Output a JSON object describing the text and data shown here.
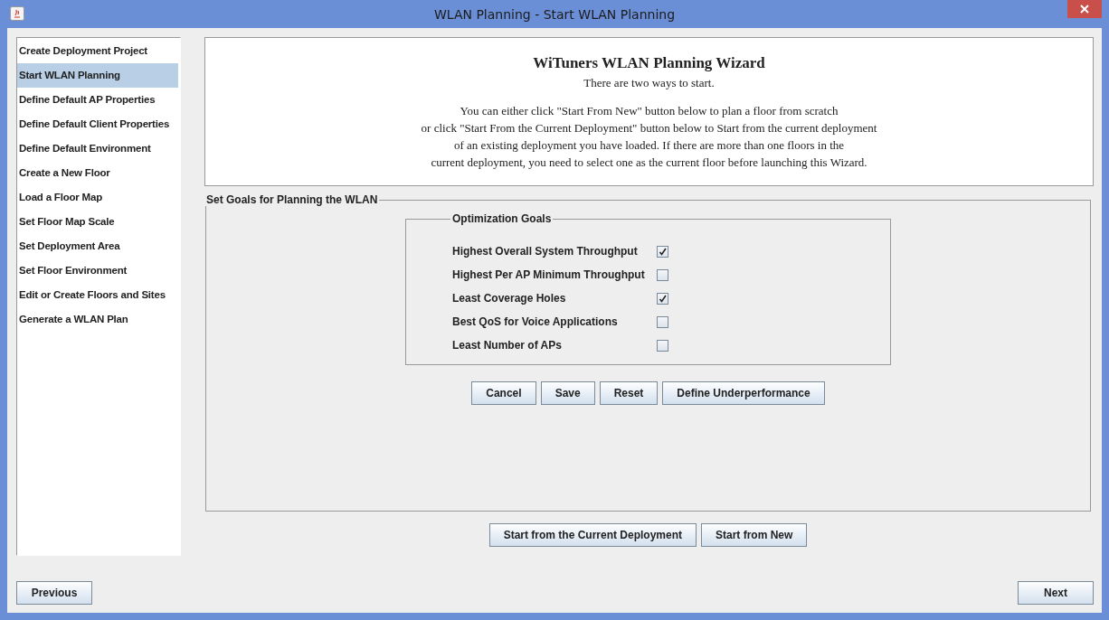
{
  "window": {
    "title": "WLAN Planning - Start WLAN Planning"
  },
  "sidebar": {
    "items": [
      {
        "label": "Create Deployment Project",
        "selected": false
      },
      {
        "label": "Start WLAN Planning",
        "selected": true
      },
      {
        "label": "Define Default AP Properties",
        "selected": false
      },
      {
        "label": "Define Default Client Properties",
        "selected": false
      },
      {
        "label": "Define Default Environment",
        "selected": false
      },
      {
        "label": "Create a New Floor",
        "selected": false
      },
      {
        "label": "Load a Floor Map",
        "selected": false
      },
      {
        "label": "Set Floor Map Scale",
        "selected": false
      },
      {
        "label": "Set Deployment Area",
        "selected": false
      },
      {
        "label": "Set Floor Environment",
        "selected": false
      },
      {
        "label": "Edit or Create Floors and Sites",
        "selected": false
      },
      {
        "label": "Generate a WLAN Plan",
        "selected": false
      }
    ]
  },
  "intro": {
    "title": "WiTuners WLAN Planning Wizard",
    "subtitle": "There are two ways to start.",
    "lines": [
      "You can either click \"Start From New\" button below to plan a floor from scratch",
      "or click \"Start From the Current Deployment\" button below to Start from the current deployment",
      "of an existing deployment you have loaded. If there are more than one floors in the",
      "current deployment, you need to select one as the current floor before launching this Wizard."
    ]
  },
  "goals_panel": {
    "title": "Set Goals for Planning the WLAN",
    "optimization": {
      "title": "Optimization Goals",
      "goals": [
        {
          "label": "Highest Overall System Throughput",
          "checked": true
        },
        {
          "label": "Highest Per AP Minimum Throughput",
          "checked": false
        },
        {
          "label": "Least Coverage Holes",
          "checked": true
        },
        {
          "label": "Best QoS for Voice Applications",
          "checked": false
        },
        {
          "label": "Least Number of APs",
          "checked": false
        }
      ]
    },
    "buttons": [
      "Cancel",
      "Save",
      "Reset",
      "Define Underperformance"
    ]
  },
  "start_buttons": [
    "Start from the Current Deployment",
    "Start from New"
  ],
  "nav": {
    "previous": "Previous",
    "next": "Next"
  }
}
